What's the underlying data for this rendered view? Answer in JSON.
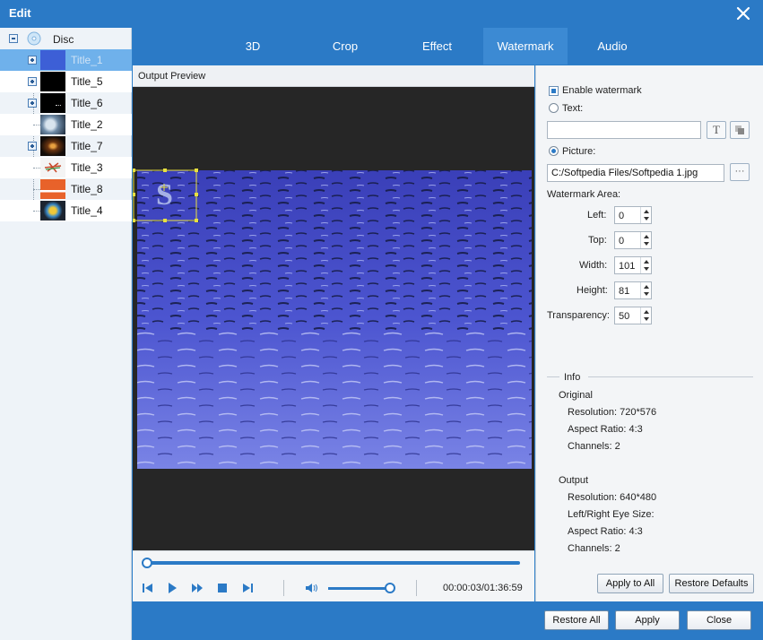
{
  "window": {
    "title": "Edit"
  },
  "tree": {
    "root": "Disc",
    "items": [
      {
        "label": "Title_1",
        "thumb": "#3d5fd6"
      },
      {
        "label": "Title_5",
        "thumb": "#000000"
      },
      {
        "label": "Title_6",
        "thumb": "#000000"
      },
      {
        "label": "Title_2",
        "thumb": "#7a9ab8"
      },
      {
        "label": "Title_7",
        "thumb": "#1a1410"
      },
      {
        "label": "Title_3",
        "thumb": "#f2f2f2"
      },
      {
        "label": "Title_8",
        "thumb": "#e8622a"
      },
      {
        "label": "Title_4",
        "thumb": "#1c2430"
      }
    ]
  },
  "tabs": [
    "3D",
    "Crop",
    "Effect",
    "Watermark",
    "Audio"
  ],
  "active_tab": "Watermark",
  "preview": {
    "header": "Output Preview",
    "watermark_letter": "S",
    "timecode": "00:00:03/01:36:59"
  },
  "watermark": {
    "enable_label": "Enable watermark",
    "text_label": "Text:",
    "text_value": "",
    "picture_label": "Picture:",
    "picture_path": "C:/Softpedia Files/Softpedia 1.jpg",
    "browse_label": "···",
    "text_style_icon": "T",
    "area_label": "Watermark Area:",
    "left_label": "Left:",
    "left_value": "0",
    "top_label": "Top:",
    "top_value": "0",
    "width_label": "Width:",
    "width_value": "101",
    "height_label": "Height:",
    "height_value": "81",
    "transparency_label": "Transparency:",
    "transparency_value": "50"
  },
  "info": {
    "title": "Info",
    "original_label": "Original",
    "original": [
      "Resolution: 720*576",
      "Aspect Ratio: 4:3",
      "Channels: 2"
    ],
    "output_label": "Output",
    "output": [
      "Resolution: 640*480",
      "Left/Right Eye Size:",
      "Aspect Ratio: 4:3",
      "Channels: 2"
    ]
  },
  "panel_buttons": {
    "apply_all": "Apply to All",
    "restore_defaults": "Restore Defaults"
  },
  "footer": {
    "restore_all": "Restore All",
    "apply": "Apply",
    "close": "Close"
  },
  "colors": {
    "accent": "#2b7ac6",
    "selection": "#6fb1eb"
  }
}
